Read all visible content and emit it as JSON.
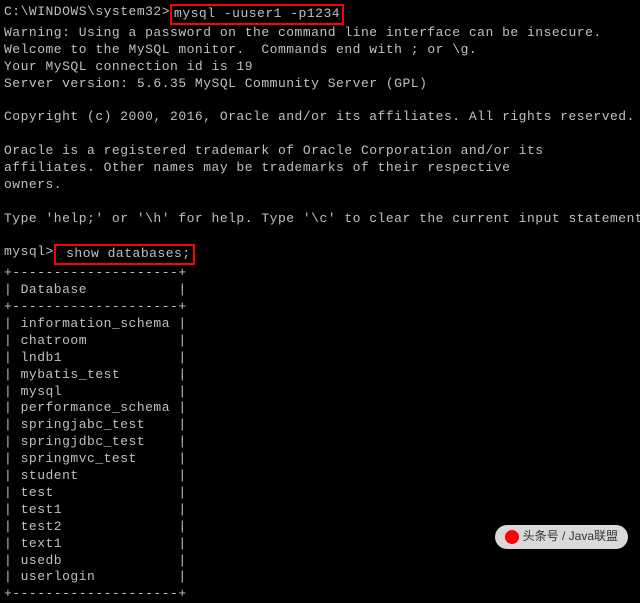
{
  "prompt1_path": "C:\\WINDOWS\\system32>",
  "prompt1_cmd": "mysql -uuser1 -p1234",
  "warning": "Warning: Using a password on the command line interface can be insecure.",
  "welcome": "Welcome to the MySQL monitor.  Commands end with ; or \\g.",
  "connection_id": "Your MySQL connection id is 19",
  "server_version": "Server version: 5.6.35 MySQL Community Server (GPL)",
  "copyright": "Copyright (c) 2000, 2016, Oracle and/or its affiliates. All rights reserved.",
  "trademark1": "Oracle is a registered trademark of Oracle Corporation and/or its",
  "trademark2": "affiliates. Other names may be trademarks of their respective",
  "trademark3": "owners.",
  "help_line": "Type 'help;' or '\\h' for help. Type '\\c' to clear the current input statement.",
  "prompt2": "mysql>",
  "cmd2": " show databases;",
  "table_border": "+--------------------+",
  "table_header": "| Database           |",
  "databases": [
    "| information_schema |",
    "| chatroom           |",
    "| lndb1              |",
    "| mybatis_test       |",
    "| mysql              |",
    "| performance_schema |",
    "| springjabc_test    |",
    "| springjdbc_test    |",
    "| springmvc_test     |",
    "| student            |",
    "| test               |",
    "| test1              |",
    "| test2              |",
    "| text1              |",
    "| usedb              |",
    "| userlogin          |"
  ],
  "watermark_text": "头条号 / Java联盟"
}
